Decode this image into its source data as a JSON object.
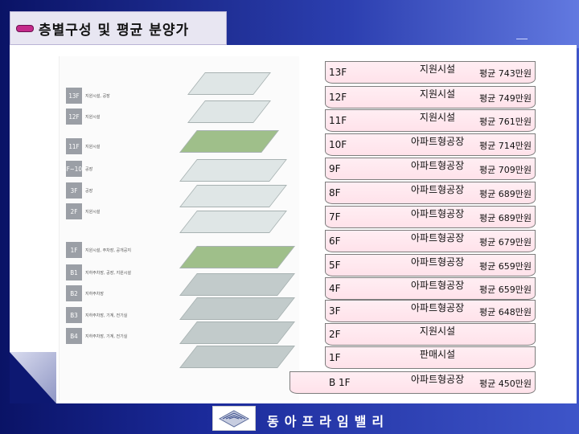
{
  "header": {
    "title": "층별구성 및 평균 분양가"
  },
  "illustration": {
    "floors": [
      {
        "code": "13F",
        "desc": "지원시설, 공장"
      },
      {
        "code": "12F",
        "desc": "지원시설"
      },
      {
        "code": "11F",
        "desc": "지원시설"
      },
      {
        "code": "4F~10F",
        "desc": "공장"
      },
      {
        "code": "3F",
        "desc": "공장"
      },
      {
        "code": "2F",
        "desc": "지원시설"
      },
      {
        "code": "1F",
        "desc": "지원시설, 주차장, 공개공지"
      },
      {
        "code": "B1",
        "desc": "지하주차장, 공장, 지원시설"
      },
      {
        "code": "B2",
        "desc": "지하주차장"
      },
      {
        "code": "B3",
        "desc": "지하주차장, 기계, 전기실"
      },
      {
        "code": "B4",
        "desc": "지하주차장, 기계, 전기실"
      }
    ]
  },
  "floor_table": [
    {
      "floor": "13F",
      "use": "지원시설",
      "price": "평균 743만원"
    },
    {
      "floor": "12F",
      "use": "지원시설",
      "price": "평균 749만원"
    },
    {
      "floor": "11F",
      "use": "지원시설",
      "price": "평균 761만원"
    },
    {
      "floor": "10F",
      "use": "아파트형공장",
      "price": "평균 714만원"
    },
    {
      "floor": "9F",
      "use": "아파트형공장",
      "price": "평균 709만원"
    },
    {
      "floor": "8F",
      "use": "아파트형공장",
      "price": "평균 689만원"
    },
    {
      "floor": "7F",
      "use": "아파트형공장",
      "price": "평균 689만원"
    },
    {
      "floor": "6F",
      "use": "아파트형공장",
      "price": "평균 679만원"
    },
    {
      "floor": "5F",
      "use": "아파트형공장",
      "price": "평균 659만원"
    },
    {
      "floor": "4F",
      "use": "아파트형공장",
      "price": "평균 659만원"
    },
    {
      "floor": "3F",
      "use": "아파트형공장",
      "price": "평균 648만원"
    },
    {
      "floor": "2F",
      "use": "지원시설",
      "price": ""
    },
    {
      "floor": "1F",
      "use": "판매시설",
      "price": ""
    },
    {
      "floor": "B 1F",
      "use": "아파트형공장",
      "price": "평균 450만원"
    }
  ],
  "footer": {
    "company": "동아프라임밸리"
  }
}
